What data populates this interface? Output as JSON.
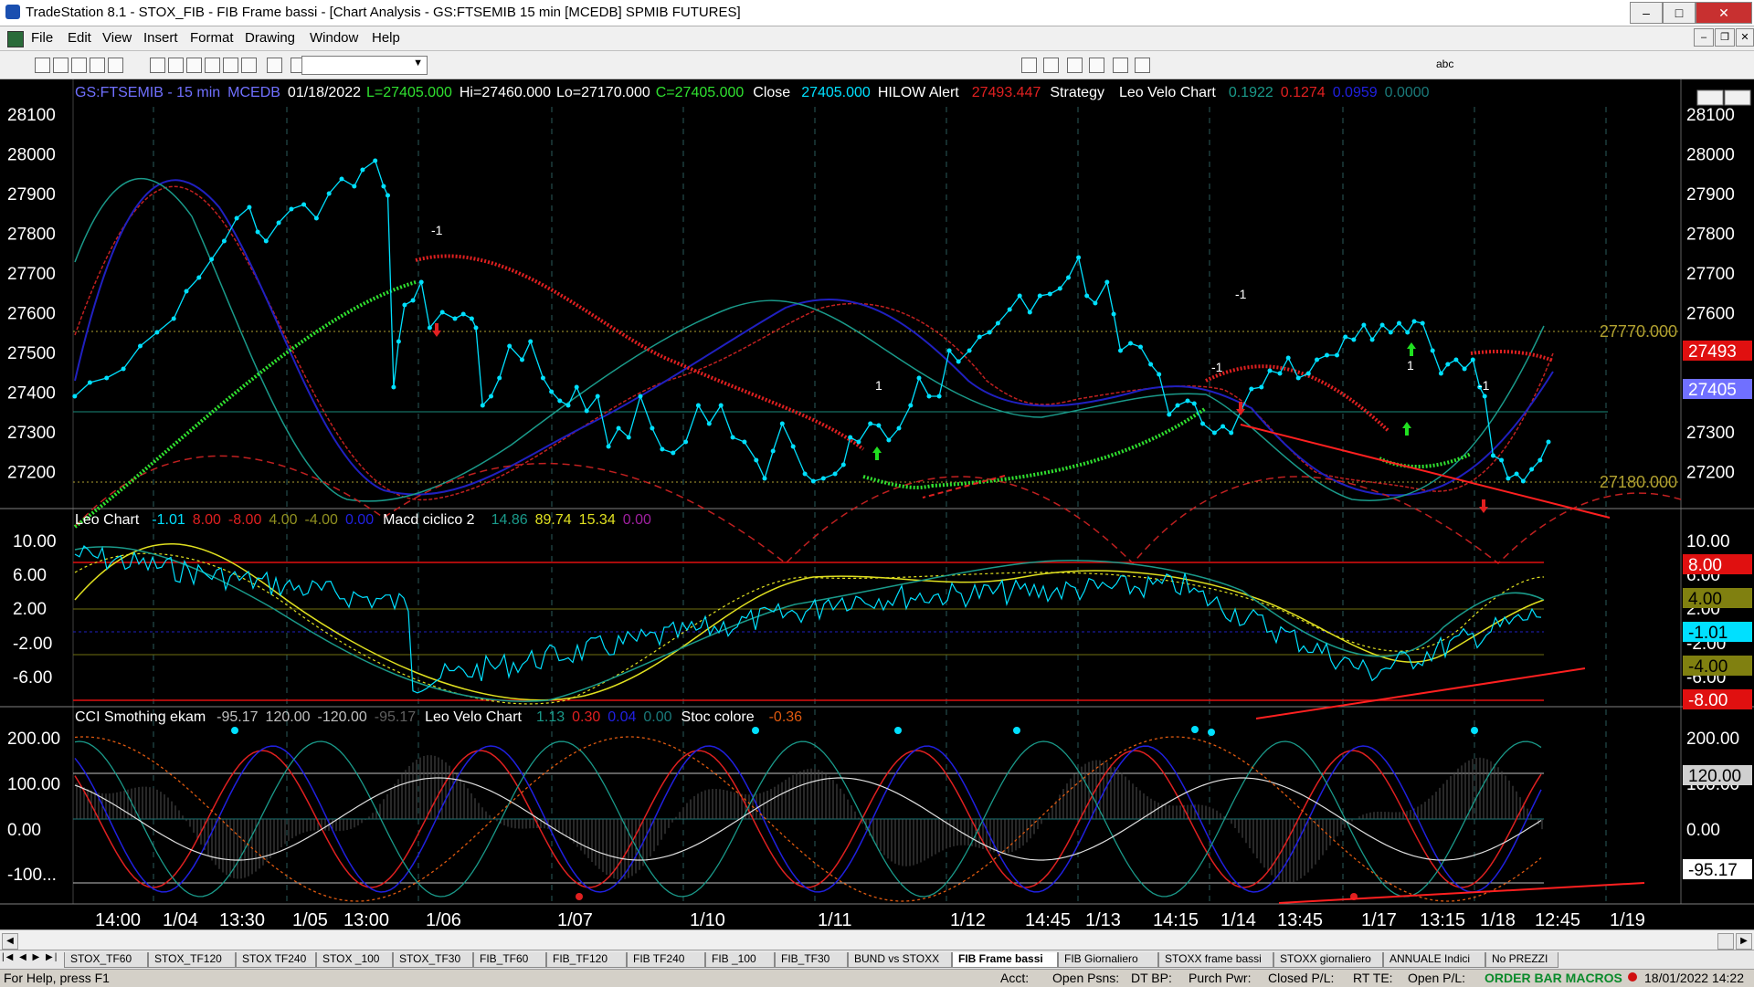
{
  "window": {
    "title": "TradeStation 8.1 - STOX_FIB - FIB Frame bassi - [Chart Analysis - GS:FTSEMIB  15 min  [MCEDB] SPMIB FUTURES]",
    "minimize_glyph": "–",
    "maximize_glyph": "□",
    "close_glyph": "✕",
    "restore_glyph": "❐"
  },
  "menu": [
    "File",
    "Edit",
    "View",
    "Insert",
    "Format",
    "Drawing",
    "Window",
    "Help"
  ],
  "toolbar": {
    "combo_arrow": "▼",
    "text_tool": "abc",
    "icons": [
      "new-document-icon",
      "open-icon",
      "save-icon",
      "print-icon",
      "print-preview-icon",
      "find-icon",
      "format-icon",
      "zoom-in-icon",
      "zoom-out-icon",
      "pointer-icon",
      "crosshair-icon",
      "trendline-icon",
      "horizontal-line-icon",
      "fibonacci-icon",
      "arrow-up-icon",
      "arrow-down-icon",
      "ellipse-icon",
      "rectangle-icon",
      "text-icon"
    ]
  },
  "chart": {
    "header": {
      "symbol": "GS:FTSEMIB - 15 min",
      "source": "MCEDB",
      "date": "01/18/2022",
      "last": "L=27405.000",
      "high": "Hi=27460.000",
      "low": "Lo=27170.000",
      "close": "C=27405.000",
      "close_label": "Close",
      "close_value": "27405.000",
      "hilow_label": "HILOW Alert",
      "hilow_value": "27493.447",
      "strategy_label": "Strategy",
      "leovelo_label": "Leo Velo Chart",
      "leovelo_values": [
        "0.1922",
        "0.1274",
        "0.0959",
        "0.0000"
      ]
    },
    "price_axis": [
      "28100",
      "28000",
      "27900",
      "27800",
      "27700",
      "27600",
      "27500",
      "27400",
      "27300",
      "27200"
    ],
    "price_levels": {
      "upper": "27770.000",
      "lower": "27180.000"
    },
    "price_tags": [
      {
        "text": "27493",
        "color": "#e01010",
        "fg": "#ffffff"
      },
      {
        "text": "27405",
        "color": "#7070ff",
        "fg": "#ffffff"
      }
    ],
    "bar_markers": [
      "-1",
      "-1",
      "1",
      "-1",
      "1",
      "-1"
    ],
    "panel2": {
      "leo_label": "Leo Chart",
      "leo_values": [
        "-1.01",
        "8.00",
        "-8.00",
        "4.00",
        "-4.00",
        "0.00"
      ],
      "macd_label": "Macd ciclico 2",
      "macd_values": [
        "14.86",
        "89.74",
        "15.34",
        "0.00"
      ],
      "axis": [
        "10.00",
        "6.00",
        "2.00",
        "-2.00",
        "-6.00"
      ],
      "tags": [
        {
          "text": "8.00",
          "color": "#e01010",
          "fg": "#ffffff"
        },
        {
          "text": "4.00",
          "color": "#808010",
          "fg": "#000000"
        },
        {
          "text": "-1.01",
          "color": "#00e0ff",
          "fg": "#000000"
        },
        {
          "text": "-4.00",
          "color": "#808010",
          "fg": "#000000"
        },
        {
          "text": "-8.00",
          "color": "#e01010",
          "fg": "#ffffff"
        }
      ]
    },
    "panel3": {
      "cci_label": "CCI Smothing ekam",
      "cci_values": [
        "-95.17",
        "120.00",
        "-120.00",
        "-95.17"
      ],
      "leovelo_label": "Leo Velo Chart",
      "leovelo_values": [
        "1.13",
        "0.30",
        "0.04",
        "0.00"
      ],
      "stoc_label": "Stoc colore",
      "stoc_value": "-0.36",
      "axis": [
        "200.00",
        "100.00",
        "0.00",
        "-100..."
      ],
      "tags": [
        {
          "text": "120.00",
          "color": "#d0d0d0",
          "fg": "#000000"
        },
        {
          "text": "-95.17",
          "color": "#ffffff",
          "fg": "#000000"
        }
      ]
    },
    "time_axis": [
      "14:00",
      "1/04",
      "13:30",
      "1/05",
      "13:00",
      "1/06",
      "1/07",
      "1/10",
      "1/11",
      "1/12",
      "14:45",
      "1/13",
      "14:15",
      "1/14",
      "13:45",
      "1/17",
      "13:15",
      "1/18",
      "12:45",
      "1/19"
    ]
  },
  "tabs": [
    "STOX_TF60",
    "STOX_TF120",
    "STOX TF240",
    "STOX _100",
    "STOX_TF30",
    "FIB_TF60",
    "FIB_TF120",
    "FIB TF240",
    "FIB _100",
    "FIB_TF30",
    "BUND vs STOXX",
    "FIB Frame bassi",
    "FIB Giornaliero",
    "STOXX frame bassi",
    "STOXX giornaliero",
    "ANNUALE Indici",
    "No PREZZI"
  ],
  "active_tab": "FIB Frame bassi",
  "status": {
    "help": "For Help, press F1",
    "acct": "Acct:",
    "open_psns": "Open Psns:",
    "dt_bp": "DT BP:",
    "purch_pwr": "Purch Pwr:",
    "closed_pl": "Closed P/L:",
    "rt_te": "RT TE:",
    "open_pl": "Open P/L:",
    "macros": "ORDER BAR  MACROS",
    "datetime": "18/01/2022 14:22"
  }
}
